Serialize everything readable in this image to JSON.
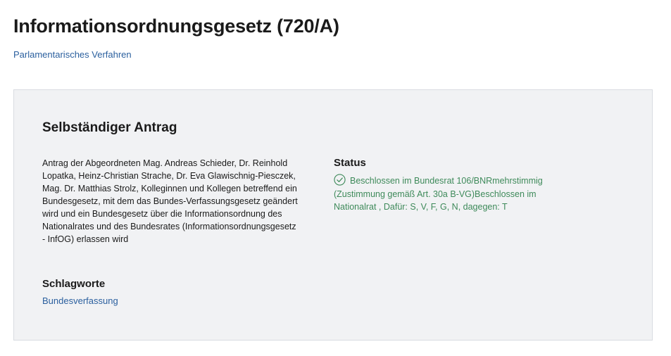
{
  "page": {
    "title": "Informationsordnungsgesetz (720/A)",
    "breadcrumb_link": "Parlamentarisches Verfahren"
  },
  "card": {
    "title": "Selbständiger Antrag",
    "description": "Antrag der Abgeordneten Mag. Andreas Schieder, Dr. Reinhold Lopatka, Heinz-Christian Strache, Dr. Eva Glawischnig-Piesczek, Mag. Dr. Matthias Strolz, Kolleginnen und Kollegen betreffend ein Bundesgesetz, mit dem das Bundes-Verfassungsgesetz geändert wird und ein Bundesgesetz über die Informationsordnung des Nationalrates und des Bundesrates (Informationsordnungsgesetz - InfOG) erlassen wird",
    "keywords_heading": "Schlagworte",
    "keywords": [
      "Bundesverfassung"
    ],
    "status": {
      "heading": "Status",
      "icon": "check-circle-icon",
      "text": "Beschlossen im Bundesrat 106/BNRmehrstimmig (Zustimmung gemäß Art. 30a B-VG)Beschlossen im Nationalrat , Dafür: S, V, F, G, N, dagegen: T",
      "color": "#3e8a5a"
    }
  },
  "colors": {
    "link": "#2a5f9e",
    "card_background": "#f1f2f4",
    "status_green": "#3e8a5a"
  }
}
